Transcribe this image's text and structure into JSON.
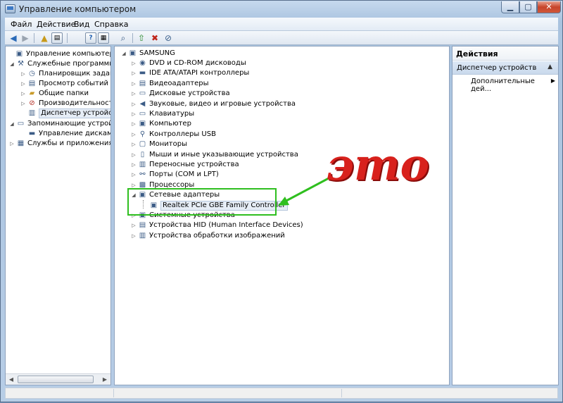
{
  "window": {
    "title": "Управление компьютером"
  },
  "menu": [
    "Файл",
    "Действие",
    "Вид",
    "Справка"
  ],
  "toolbar": {
    "buttons": [
      "back-arrow-icon",
      "forward-arrow-icon",
      "up-folder-icon",
      "show-tree-icon",
      "help-icon",
      "properties-icon",
      "scan-hardware-icon",
      "update-driver-icon",
      "uninstall-icon",
      "disable-icon"
    ]
  },
  "left_tree": [
    {
      "label": "Управление компьютером (л",
      "level": 0,
      "exp": "",
      "icon": "computer-management-icon"
    },
    {
      "label": "Служебные программы",
      "level": 1,
      "exp": "◢",
      "icon": "tools-icon"
    },
    {
      "label": "Планировщик заданий",
      "level": 2,
      "exp": "▷",
      "icon": "clock-icon"
    },
    {
      "label": "Просмотр событий",
      "level": 2,
      "exp": "▷",
      "icon": "event-viewer-icon"
    },
    {
      "label": "Общие папки",
      "level": 2,
      "exp": "▷",
      "icon": "shared-folder-icon"
    },
    {
      "label": "Производительность",
      "level": 2,
      "exp": "▷",
      "icon": "performance-icon"
    },
    {
      "label": "Диспетчер устройств",
      "level": 2,
      "exp": "",
      "icon": "device-manager-icon",
      "selected": true
    },
    {
      "label": "Запоминающие устройств",
      "level": 1,
      "exp": "◢",
      "icon": "storage-icon"
    },
    {
      "label": "Управление дисками",
      "level": 2,
      "exp": "",
      "icon": "disk-management-icon"
    },
    {
      "label": "Службы и приложения",
      "level": 1,
      "exp": "▷",
      "icon": "services-icon"
    }
  ],
  "device_tree": {
    "root": "SAMSUNG",
    "categories": [
      "DVD и CD-ROM дисководы",
      "IDE ATA/ATAPI контроллеры",
      "Видеоадаптеры",
      "Дисковые устройства",
      "Звуковые, видео и игровые устройства",
      "Клавиатуры",
      "Компьютер",
      "Контроллеры USB",
      "Мониторы",
      "Мыши и иные указывающие устройства",
      "Переносные устройства",
      "Порты (COM и LPT)",
      "Процессоры",
      "Сетевые адаптеры",
      "Системные устройства",
      "Устройства HID (Human Interface Devices)",
      "Устройства обработки изображений"
    ],
    "expanded_child": "Realtek PCIe GBE Family Controller"
  },
  "actions": {
    "header": "Действия",
    "group": "Диспетчер устройств",
    "item": "Дополнительные дей..."
  },
  "annotation": {
    "text": "это",
    "color": "#d8211c",
    "arrow_color": "#2fbf1f"
  }
}
